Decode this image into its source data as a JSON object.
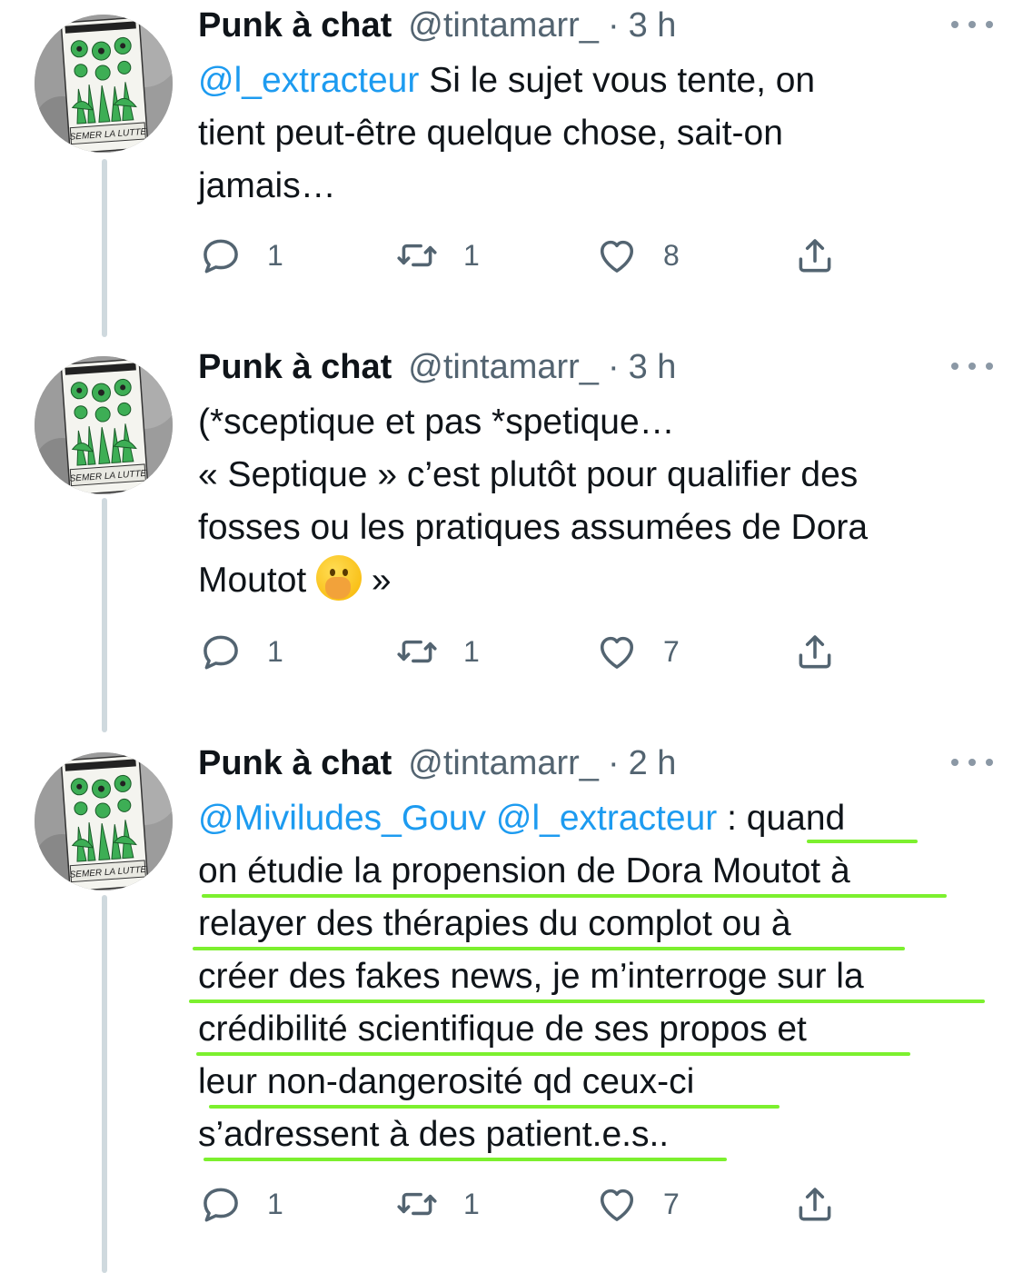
{
  "tweets": [
    {
      "name": "Punk à chat",
      "handle": "@tintamarr_",
      "separator": "·",
      "time": "3 h",
      "text_lines": [
        [
          {
            "t": "@l_extracteur",
            "mention": true
          },
          {
            "t": " Si le sujet vous tente, on"
          }
        ],
        [
          {
            "t": "tient peut-être quelque chose, sait-on"
          }
        ],
        [
          {
            "t": "jamais…"
          }
        ]
      ],
      "replies": "1",
      "retweets": "1",
      "likes": "8"
    },
    {
      "name": "Punk à chat",
      "handle": "@tintamarr_",
      "separator": "·",
      "time": "3 h",
      "text_lines": [
        [
          {
            "t": "(*sceptique et pas *spetique…"
          }
        ],
        [
          {
            "t": "« Septique » c’est plutôt pour qualifier des"
          }
        ],
        [
          {
            "t": "fosses ou les pratiques assumées de Dora"
          }
        ],
        [
          {
            "t": "Moutot "
          },
          {
            "emoji": "face-with-hand-over-mouth"
          },
          {
            "t": " »"
          }
        ]
      ],
      "replies": "1",
      "retweets": "1",
      "likes": "7"
    },
    {
      "name": "Punk à chat",
      "handle": "@tintamarr_",
      "separator": "·",
      "time": "2 h",
      "text_lines": [
        [
          {
            "t": "@Miviludes_Gouv",
            "mention": true
          },
          {
            "t": " "
          },
          {
            "t": "@l_extracteur",
            "mention": true
          },
          {
            "t": " : quand"
          }
        ],
        [
          {
            "t": "on étudie la propension de Dora Moutot à"
          }
        ],
        [
          {
            "t": "relayer des thérapies du complot ou à"
          }
        ],
        [
          {
            "t": "créer des fakes news, je m’interroge sur la"
          }
        ],
        [
          {
            "t": "crédibilité scientifique de ses propos et"
          }
        ],
        [
          {
            "t": "leur non-dangerosité qd ceux-ci"
          }
        ],
        [
          {
            "t": "s’adressent à des patient.e.s.."
          }
        ]
      ],
      "replies": "1",
      "retweets": "1",
      "likes": "7"
    }
  ],
  "avatar_caption": "SEMER LA LUTTE",
  "icons": {
    "reply": "reply-icon",
    "retweet": "retweet-icon",
    "like": "heart-icon",
    "share": "share-icon",
    "more": "more-icon"
  },
  "colors": {
    "text": "#0f1419",
    "secondary": "#536471",
    "mention": "#1d9bf0",
    "thread_line": "#cfd9de",
    "highlight": "#7cf02e"
  }
}
